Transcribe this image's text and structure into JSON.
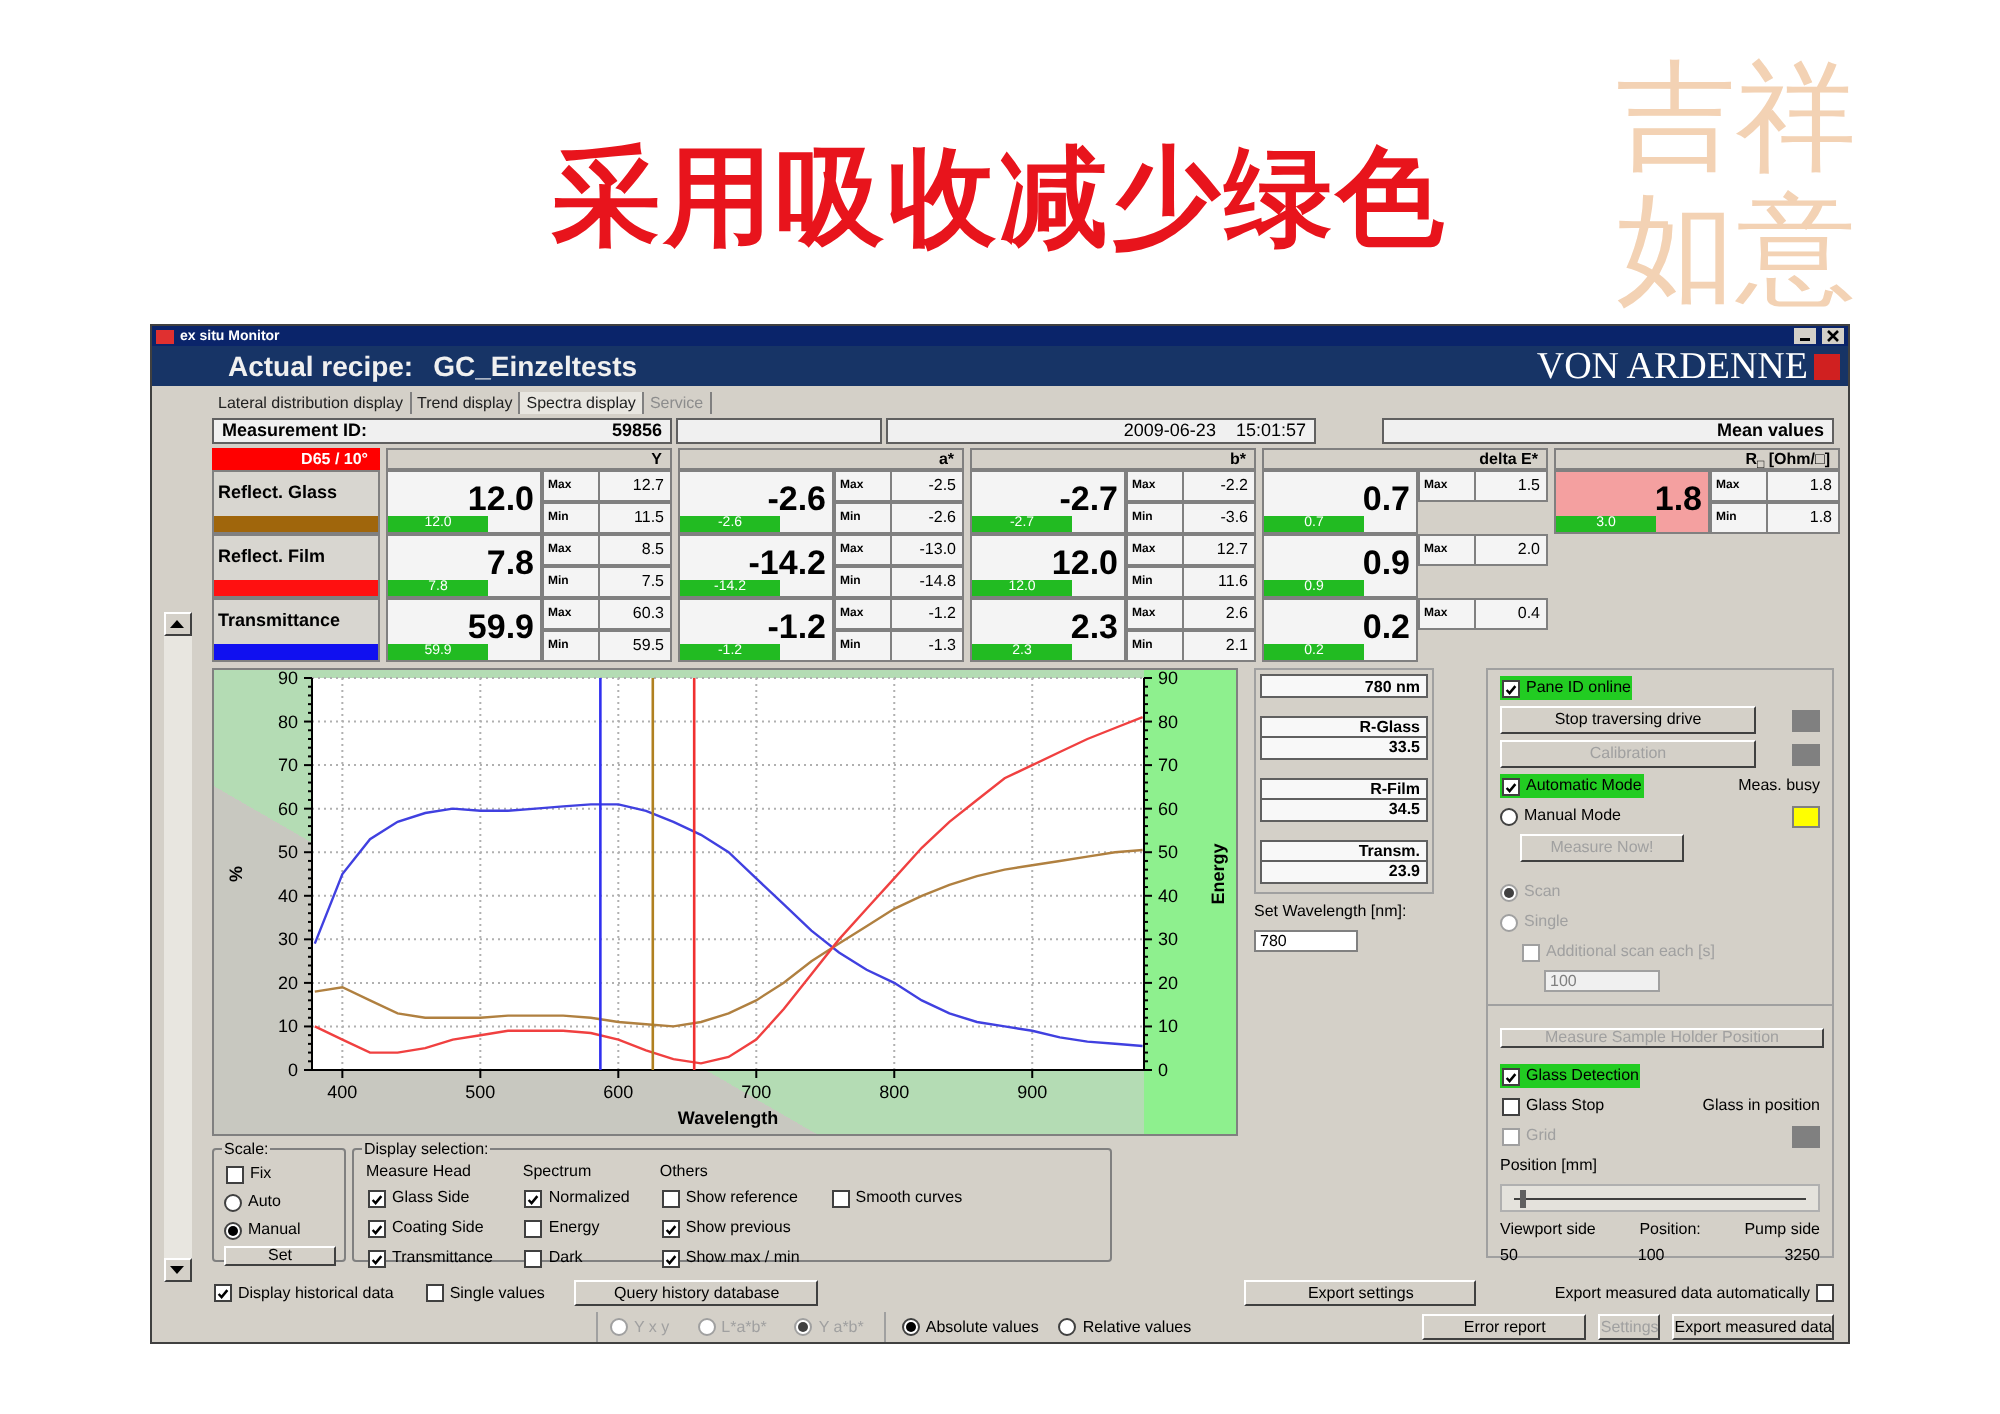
{
  "slide_title": "采用吸收减少绿色",
  "logo_text": "吉祥如意",
  "window": {
    "caption": "ex situ Monitor",
    "recipe_label": "Actual recipe:",
    "recipe": "GC_Einzeltests",
    "brand": "VON ARDENNE"
  },
  "tabs": [
    {
      "label": "Lateral distribution display",
      "selected": false,
      "disabled": false
    },
    {
      "label": "Trend display",
      "selected": false,
      "disabled": false
    },
    {
      "label": "Spectra display",
      "selected": true,
      "disabled": false
    },
    {
      "label": "Service",
      "selected": false,
      "disabled": true
    }
  ],
  "measurement": {
    "id_label": "Measurement ID:",
    "id": "59856",
    "date": "2009-06-23",
    "time": "15:01:57",
    "mode": "Mean values"
  },
  "illuminant": "D65 / 10°",
  "rows": [
    {
      "label": "Reflect. Glass",
      "color": "#a0660c"
    },
    {
      "label": "Reflect. Film",
      "color": "#ff1010"
    },
    {
      "label": "Transmittance",
      "color": "#1010f0"
    }
  ],
  "groups": [
    {
      "header": "Y",
      "cells": [
        {
          "value": "12.0",
          "bar": "12.0",
          "alarm": false,
          "max_label": "Max",
          "max": "12.7",
          "min_label": "Min",
          "min": "11.5"
        },
        {
          "value": "7.8",
          "bar": "7.8",
          "alarm": false,
          "max_label": "Max",
          "max": "8.5",
          "min_label": "Min",
          "min": "7.5"
        },
        {
          "value": "59.9",
          "bar": "59.9",
          "alarm": false,
          "max_label": "Max",
          "max": "60.3",
          "min_label": "Min",
          "min": "59.5"
        }
      ]
    },
    {
      "header": "a*",
      "cells": [
        {
          "value": "-2.6",
          "bar": "-2.6",
          "alarm": false,
          "max_label": "Max",
          "max": "-2.5",
          "min_label": "Min",
          "min": "-2.6"
        },
        {
          "value": "-14.2",
          "bar": "-14.2",
          "alarm": false,
          "max_label": "Max",
          "max": "-13.0",
          "min_label": "Min",
          "min": "-14.8"
        },
        {
          "value": "-1.2",
          "bar": "-1.2",
          "alarm": false,
          "max_label": "Max",
          "max": "-1.2",
          "min_label": "Min",
          "min": "-1.3"
        }
      ]
    },
    {
      "header": "b*",
      "cells": [
        {
          "value": "-2.7",
          "bar": "-2.7",
          "alarm": false,
          "max_label": "Max",
          "max": "-2.2",
          "min_label": "Min",
          "min": "-3.6"
        },
        {
          "value": "12.0",
          "bar": "12.0",
          "alarm": false,
          "max_label": "Max",
          "max": "12.7",
          "min_label": "Min",
          "min": "11.6"
        },
        {
          "value": "2.3",
          "bar": "2.3",
          "alarm": false,
          "max_label": "Max",
          "max": "2.6",
          "min_label": "Min",
          "min": "2.1"
        }
      ]
    },
    {
      "header": "delta E*",
      "cells": [
        {
          "value": "0.7",
          "bar": "0.7",
          "alarm": false,
          "max_label": "Max",
          "max": "1.5"
        },
        {
          "value": "0.9",
          "bar": "0.9",
          "alarm": false,
          "max_label": "Max",
          "max": "2.0"
        },
        {
          "value": "0.2",
          "bar": "0.2",
          "alarm": false,
          "max_label": "Max",
          "max": "0.4"
        }
      ]
    },
    {
      "header": "R$_{□}$ [Ohm/□]",
      "cells": [
        {
          "value": "1.8",
          "bar": "3.0",
          "alarm": true,
          "max_label": "Max",
          "max": "1.8",
          "min_label": "Min",
          "min": "1.8"
        }
      ]
    }
  ],
  "chart": {
    "chart_data": {
      "type": "line",
      "xlabel": "Wavelength",
      "ylabel": "%",
      "x": [
        380,
        400,
        420,
        440,
        460,
        480,
        500,
        520,
        540,
        560,
        580,
        600,
        620,
        640,
        660,
        680,
        700,
        720,
        740,
        760,
        780,
        800,
        820,
        840,
        860,
        880,
        900,
        920,
        940,
        960,
        980
      ],
      "series": [
        {
          "color": "#4040e0",
          "values": [
            29,
            45,
            53,
            57,
            59,
            60,
            59.5,
            59.5,
            60,
            60.5,
            61,
            61,
            59.5,
            57,
            54,
            50,
            44,
            38,
            32,
            27,
            23,
            20,
            16,
            13,
            11,
            10,
            9,
            7.5,
            6.5,
            6,
            5.5
          ]
        },
        {
          "color": "#b08040",
          "values": [
            18,
            19,
            16,
            13,
            12,
            12,
            12,
            12.5,
            12.5,
            12.5,
            12,
            11,
            10.5,
            10,
            11,
            13,
            16,
            20,
            25,
            29,
            33,
            37,
            40,
            42.5,
            44.5,
            46,
            47,
            48,
            49,
            50,
            50.5
          ]
        },
        {
          "color": "#f04040",
          "values": [
            10,
            7,
            4,
            4,
            5,
            7,
            8,
            9,
            9,
            9,
            8.5,
            7,
            4.5,
            2.5,
            1.5,
            3,
            7,
            14,
            22,
            30,
            37,
            44,
            51,
            57,
            62,
            67,
            70,
            73,
            76,
            78.5,
            81
          ]
        }
      ],
      "xlim": [
        378,
        981
      ],
      "ylim": [
        0,
        90
      ],
      "xticks": [
        400,
        500,
        600,
        700,
        800,
        900
      ],
      "yticks": [
        90,
        80,
        70,
        60,
        50,
        40,
        30,
        20,
        10,
        0
      ],
      "grid": true,
      "ref_lines": [
        {
          "axis": "x",
          "value": 587,
          "color": "#3030f0"
        },
        {
          "axis": "x",
          "value": 625,
          "color": "#b08020"
        },
        {
          "axis": "x",
          "value": 655,
          "color": "#f03030"
        }
      ]
    },
    "left_axis": {
      "ticks": [
        "90",
        "80",
        "70",
        "60",
        "50",
        "40",
        "30",
        "20",
        "10",
        "0"
      ]
    },
    "right_axis": {
      "label": "Energy",
      "ticks": [
        "90",
        "80",
        "70",
        "60",
        "50",
        "40",
        "30",
        "20",
        "10",
        "0"
      ]
    }
  },
  "readouts": [
    {
      "kind": "single",
      "value": "780 nm"
    },
    {
      "kind": "pair",
      "label": "R-Glass",
      "value": "33.5"
    },
    {
      "kind": "pair",
      "label": "R-Film",
      "value": "34.5"
    },
    {
      "kind": "pair",
      "label": "Transm.",
      "value": "23.9"
    }
  ],
  "set_wavelength": {
    "label": "Set Wavelength [nm]:",
    "value": "780"
  },
  "control_panel": {
    "pane_id": {
      "label": "Pane ID online",
      "checked": true
    },
    "stop_button": {
      "label": "Stop traversing drive",
      "disabled": false,
      "color": "#808080"
    },
    "calibration_button": {
      "label": "Calibration",
      "disabled": true,
      "color": "#808080"
    },
    "automatic_mode": {
      "label": "Automatic Mode",
      "checked": true
    },
    "meas_busy": {
      "label": "Meas. busy",
      "color": "#ffff00"
    },
    "manual_mode": {
      "label": "Manual Mode",
      "selected": false
    },
    "measure_now": {
      "label": "Measure Now!",
      "disabled": true
    },
    "scan_options": [
      {
        "label": "Scan",
        "selected": true,
        "disabled": true
      },
      {
        "label": "Single",
        "selected": false,
        "disabled": true
      }
    ],
    "additional_scan": {
      "label": "Additional scan each [s]",
      "checked": false,
      "disabled": true
    },
    "scan_interval": {
      "value": "100",
      "disabled": true
    },
    "holder_button": {
      "label": "Measure Sample Holder Position",
      "disabled": true
    },
    "glass_detection": {
      "label": "Glass Detection",
      "checked": true
    },
    "glass_stop": {
      "label": "Glass Stop",
      "checked": false
    },
    "glass_in_position": {
      "label": "Glass in position",
      "color": "#808080"
    },
    "grid": {
      "label": "Grid",
      "checked": false,
      "disabled": true
    },
    "position": {
      "label": "Position [mm]",
      "level": 0.02,
      "left_label": "Viewport side",
      "left_value": "50",
      "center_label": "Position:",
      "center_value": "100",
      "right_label": "Pump side",
      "right_value": "3250"
    }
  },
  "scale": {
    "label": "Scale:",
    "fix": {
      "label": "Fix",
      "checked": false
    },
    "options": [
      {
        "label": "Auto",
        "selected": false
      },
      {
        "label": "Manual",
        "selected": true
      }
    ],
    "set_button": "Set"
  },
  "display_selection": {
    "label": "Display selection:",
    "columns": [
      {
        "header": "Measure Head",
        "items": [
          {
            "label": "Glass Side",
            "checked": true
          },
          {
            "label": "Coating Side",
            "checked": true
          },
          {
            "label": "Transmittance",
            "checked": true
          }
        ]
      },
      {
        "header": "Spectrum",
        "items": [
          {
            "label": "Normalized",
            "checked": true
          },
          {
            "label": "Energy",
            "checked": false
          },
          {
            "label": "Dark",
            "checked": false
          }
        ]
      },
      {
        "header": "Others",
        "items": [
          {
            "label": "Show reference",
            "checked": false
          },
          {
            "label": "Show previous",
            "checked": true
          },
          {
            "label": "Show max / min",
            "checked": true
          }
        ]
      },
      {
        "items": [
          {
            "label": "Smooth curves",
            "checked": false
          }
        ]
      }
    ]
  },
  "footer": {
    "historical": {
      "label": "Display historical data",
      "checked": true
    },
    "single_values": {
      "label": "Single values",
      "checked": false
    },
    "query_button": "Query history database",
    "export_settings_button": "Export settings",
    "auto_export": {
      "label": "Export measured data automatically",
      "checked": false
    }
  },
  "status_row": {
    "color_space": [
      {
        "label": "Y x y",
        "selected": false,
        "disabled": true
      },
      {
        "label": "L*a*b*",
        "selected": false,
        "disabled": true
      },
      {
        "label": "Y a*b*",
        "selected": true,
        "disabled": true
      }
    ],
    "value_mode": [
      {
        "label": "Absolute values",
        "selected": true
      },
      {
        "label": "Relative values",
        "selected": false
      }
    ],
    "buttons": [
      {
        "label": "Error report",
        "disabled": false
      },
      {
        "label": "Settings",
        "disabled": true
      },
      {
        "label": "Export measured data",
        "disabled": false
      }
    ]
  }
}
